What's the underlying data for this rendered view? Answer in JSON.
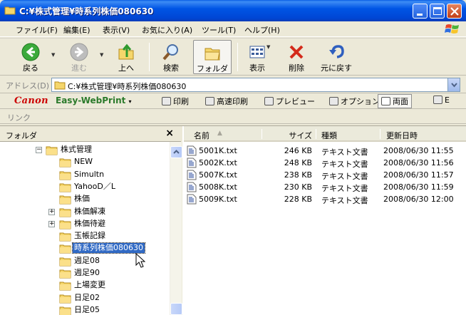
{
  "window": {
    "title": "C:¥株式管理¥時系列株価080630",
    "colors": {
      "titlebar": "#0055E5",
      "selection": "#316AC5"
    }
  },
  "menu": [
    "ファイル(F)",
    "編集(E)",
    "表示(V)",
    "お気に入り(A)",
    "ツール(T)",
    "ヘルプ(H)"
  ],
  "toolbar": {
    "back": "戻る",
    "forward": "進む",
    "up": "上へ",
    "search": "検索",
    "folders": "フォルダ",
    "view": "表示",
    "delete": "削除",
    "undo": "元に戻す"
  },
  "address": {
    "label": "アドレス(D)",
    "value": "C:¥株式管理¥時系列株価080630"
  },
  "canon": {
    "brand": "Canon",
    "product": "Easy-WebPrint",
    "print": "印刷",
    "fast_print": "高速印刷",
    "preview": "プレビュー",
    "options": "オプション",
    "duplex": "両面",
    "more": "E"
  },
  "links": {
    "label": "リンク"
  },
  "folder_pane": {
    "title": "フォルダ",
    "close": "×",
    "items": [
      {
        "name": "株式管理",
        "level": 0,
        "expander": "−"
      },
      {
        "name": "NEW",
        "level": 1,
        "expander": ""
      },
      {
        "name": "Simultn",
        "level": 1,
        "expander": ""
      },
      {
        "name": "YahooD／L",
        "level": 1,
        "expander": ""
      },
      {
        "name": "株価",
        "level": 1,
        "expander": ""
      },
      {
        "name": "株価解凍",
        "level": 1,
        "expander": "+"
      },
      {
        "name": "株価待避",
        "level": 1,
        "expander": "+"
      },
      {
        "name": "玉帳記録",
        "level": 1,
        "expander": ""
      },
      {
        "name": "時系列株価080630",
        "level": 1,
        "expander": "",
        "selected": true
      },
      {
        "name": "週足08",
        "level": 1,
        "expander": ""
      },
      {
        "name": "週足90",
        "level": 1,
        "expander": ""
      },
      {
        "name": "上場変更",
        "level": 1,
        "expander": ""
      },
      {
        "name": "日足02",
        "level": 1,
        "expander": ""
      },
      {
        "name": "日足05",
        "level": 1,
        "expander": ""
      }
    ]
  },
  "file_list": {
    "columns": {
      "name": "名前",
      "size": "サイズ",
      "type": "種類",
      "modified": "更新日時"
    },
    "rows": [
      {
        "name": "5001K.txt",
        "size": "246 KB",
        "type": "テキスト文書",
        "modified": "2008/06/30 11:55"
      },
      {
        "name": "5002K.txt",
        "size": "248 KB",
        "type": "テキスト文書",
        "modified": "2008/06/30 11:56"
      },
      {
        "name": "5007K.txt",
        "size": "238 KB",
        "type": "テキスト文書",
        "modified": "2008/06/30 11:57"
      },
      {
        "name": "5008K.txt",
        "size": "230 KB",
        "type": "テキスト文書",
        "modified": "2008/06/30 11:59"
      },
      {
        "name": "5009K.txt",
        "size": "228 KB",
        "type": "テキスト文書",
        "modified": "2008/06/30 12:00"
      }
    ]
  }
}
